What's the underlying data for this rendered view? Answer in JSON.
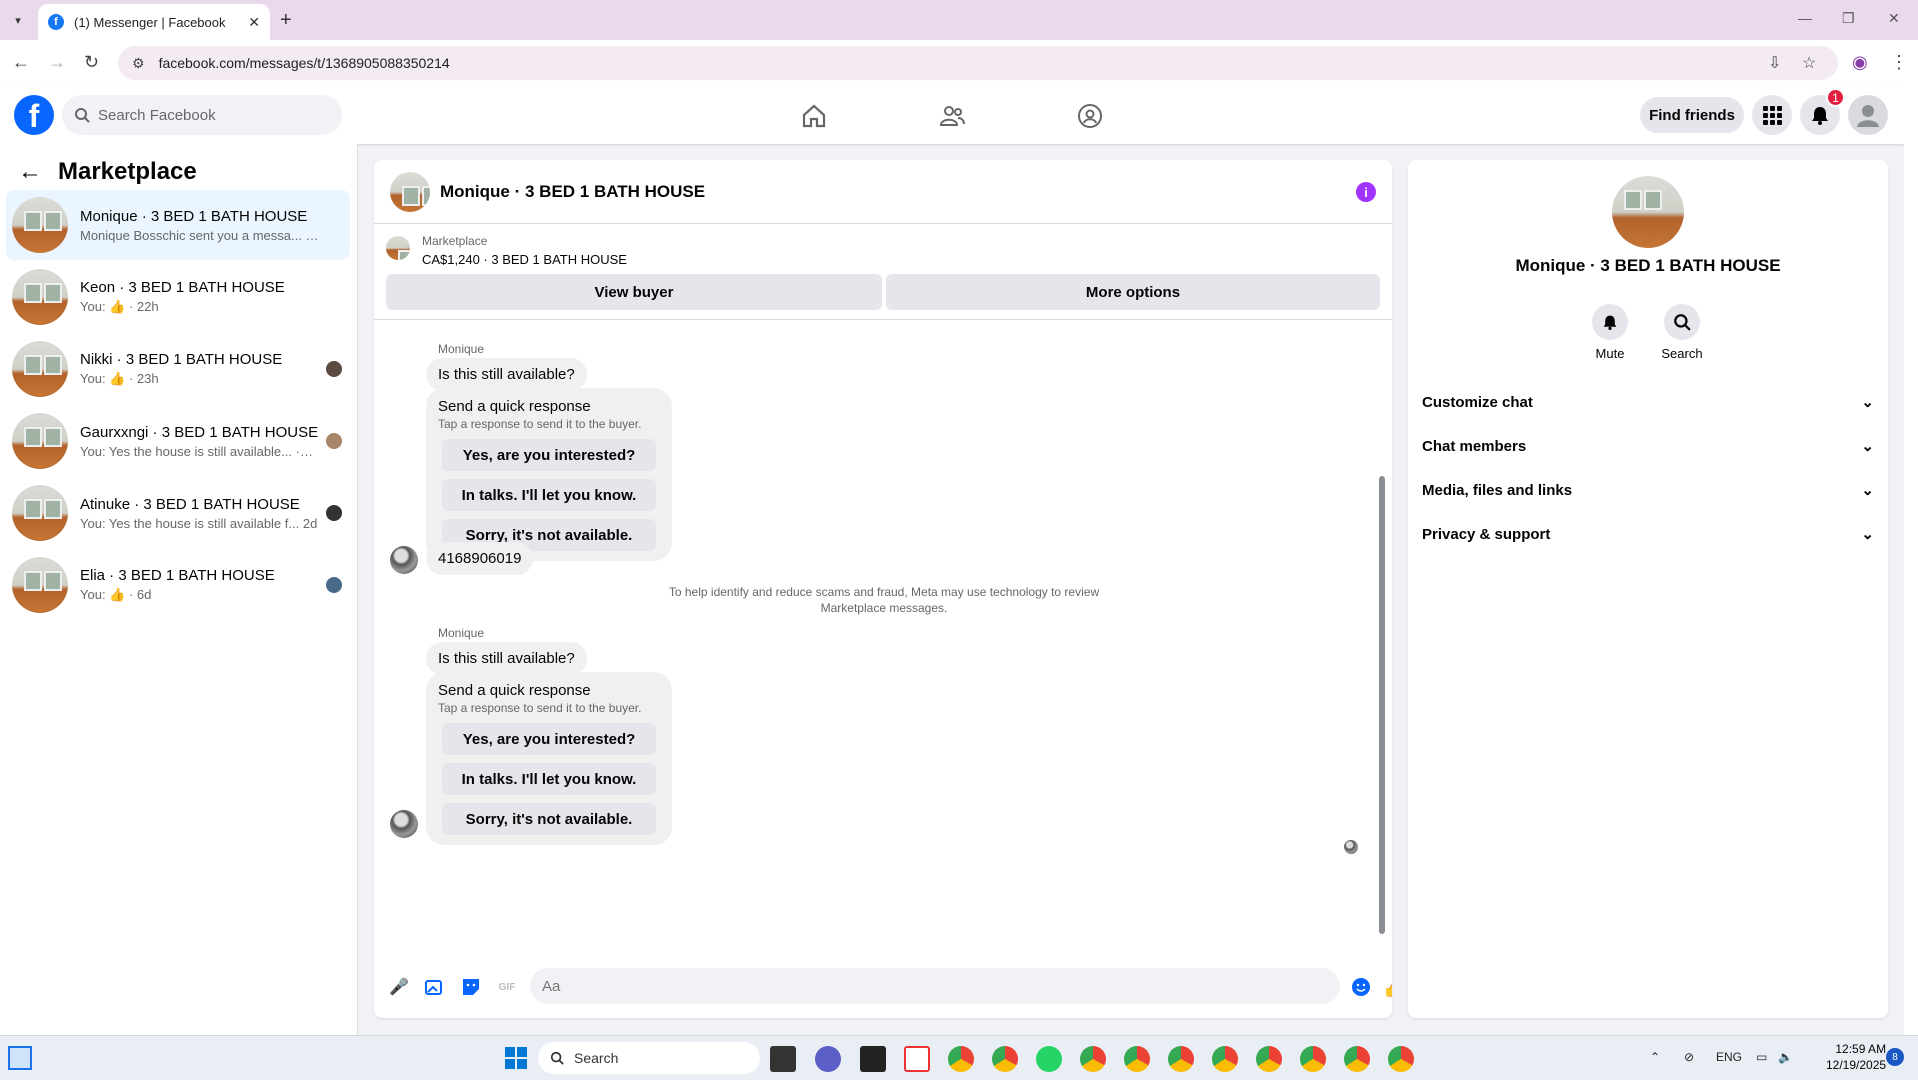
{
  "browser": {
    "tab_title": "(1) Messenger | Facebook",
    "url": "facebook.com/messages/t/1368905088350214"
  },
  "fb": {
    "search_placeholder": "Search Facebook",
    "find_friends": "Find friends",
    "notification_count": "1"
  },
  "sidebar": {
    "title": "Marketplace",
    "conversations": [
      {
        "name": "Monique · 3 BED 1 BATH HOUSE",
        "preview": "Monique Bosschic sent you a messa... ·26m"
      },
      {
        "name": "Keon · 3 BED 1 BATH HOUSE",
        "preview": "You: 👍 · 22h"
      },
      {
        "name": "Nikki · 3 BED 1 BATH HOUSE",
        "preview": "You: 👍 · 23h"
      },
      {
        "name": "Gaurxxngi · 3 BED 1 BATH HOUSE",
        "preview": "You: Yes the house is still available... ·23h"
      },
      {
        "name": "Atinuke · 3 BED 1 BATH HOUSE",
        "preview": "You: Yes the house is still available f... 2d"
      },
      {
        "name": "Elia · 3 BED 1 BATH HOUSE",
        "preview": "You: 👍 · 6d"
      }
    ]
  },
  "chat": {
    "title": "Monique · 3 BED 1 BATH HOUSE",
    "listing_label": "Marketplace",
    "listing_price": "CA$1,240 · 3 BED 1 BATH HOUSE",
    "view_buyer": "View buyer",
    "more_options": "More options",
    "sender": "Monique",
    "message1": "Is this still available?",
    "quick_title": "Send a quick response",
    "quick_sub": "Tap a response to send it to the buyer.",
    "quick_options": [
      "Yes, are you interested?",
      "In talks. I'll let you know.",
      "Sorry, it's not available."
    ],
    "phone_message": "4168906019",
    "notice": "To help identify and reduce scams and fraud, Meta may use technology to review Marketplace messages.",
    "composer_placeholder": "Aa"
  },
  "rpanel": {
    "name": "Monique · 3 BED 1 BATH HOUSE",
    "mute": "Mute",
    "search": "Search",
    "sections": [
      "Customize chat",
      "Chat members",
      "Media, files and links",
      "Privacy & support"
    ]
  },
  "taskbar": {
    "search": "Search",
    "lang": "ENG",
    "time": "12:59 AM",
    "date": "12/19/2025",
    "notif": "8"
  }
}
